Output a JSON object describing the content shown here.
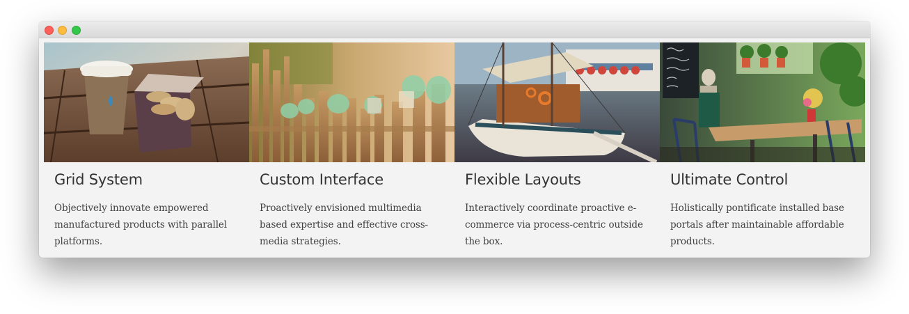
{
  "window": {
    "traffic_lights": [
      "close",
      "minimize",
      "zoom"
    ]
  },
  "features": [
    {
      "image": "coffee-cup-and-cookies-photo",
      "title": "Grid System",
      "description": "Objectively innovate empowered manufactured products with parallel platforms."
    },
    {
      "image": "glass-bottles-on-fence-photo",
      "title": "Custom Interface",
      "description": "Proactively envisioned multimedia based expertise and effective cross-media strategies."
    },
    {
      "image": "sailboat-in-harbor-photo",
      "title": "Flexible Layouts",
      "description": "Interactively coordinate proactive e-commerce via process-centric outside the box."
    },
    {
      "image": "cafe-terrace-with-chalkboard-photo",
      "title": "Ultimate Control",
      "description": "Holistically pontificate installed base portals after maintainable affordable products."
    }
  ]
}
